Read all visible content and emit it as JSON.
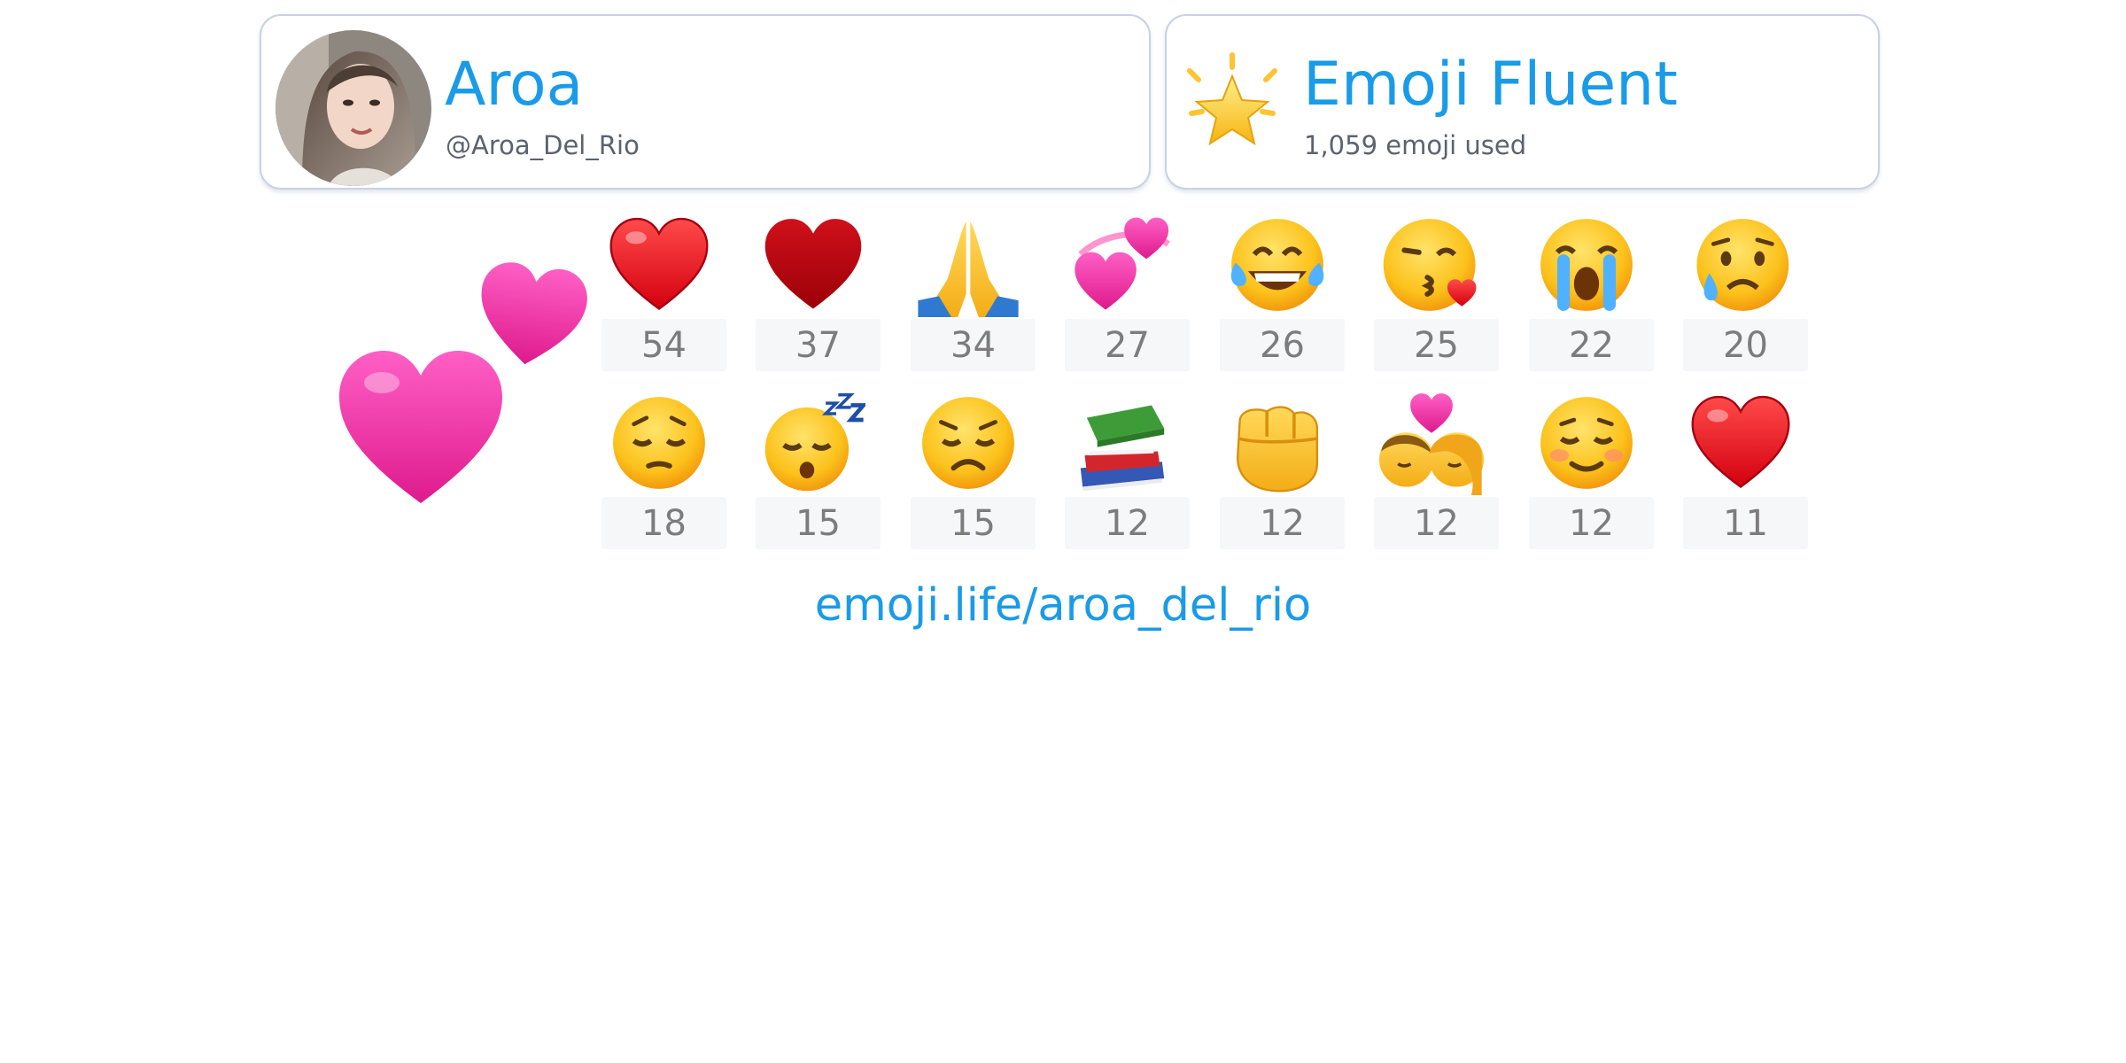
{
  "profile": {
    "name": "Aroa",
    "handle": "@Aroa_Del_Rio"
  },
  "badge": {
    "title": "Emoji Fluent",
    "subtitle": "1,059 emoji used",
    "icon": "glowing-star-icon"
  },
  "feature_icon": "two-hearts-icon",
  "top_emoji": [
    {
      "icon": "red-heart-icon",
      "count": "54"
    },
    {
      "icon": "dark-red-heart-icon",
      "count": "37"
    },
    {
      "icon": "folded-hands-icon",
      "count": "34"
    },
    {
      "icon": "revolving-hearts-icon",
      "count": "27"
    },
    {
      "icon": "tears-of-joy-face-icon",
      "count": "26"
    },
    {
      "icon": "face-blowing-kiss-icon",
      "count": "25"
    },
    {
      "icon": "loudly-crying-face-icon",
      "count": "22"
    },
    {
      "icon": "crying-face-icon",
      "count": "20"
    },
    {
      "icon": "pensive-face-icon",
      "count": "18"
    },
    {
      "icon": "sleeping-face-icon",
      "count": "15"
    },
    {
      "icon": "disappointed-face-icon",
      "count": "15"
    },
    {
      "icon": "books-icon",
      "count": "12"
    },
    {
      "icon": "oncoming-fist-icon",
      "count": "12"
    },
    {
      "icon": "kiss-couple-icon",
      "count": "12"
    },
    {
      "icon": "smiling-face-icon",
      "count": "12"
    },
    {
      "icon": "red-heart-icon",
      "count": "11"
    }
  ],
  "footer": {
    "link": "emoji.life/aroa_del_rio"
  },
  "colors": {
    "accent": "#1a9be8",
    "card_border": "#c9d2e3",
    "count_bg": "#f6f7f9",
    "count_text": "#7c7c7c",
    "subtitle_text": "#5b6270"
  }
}
